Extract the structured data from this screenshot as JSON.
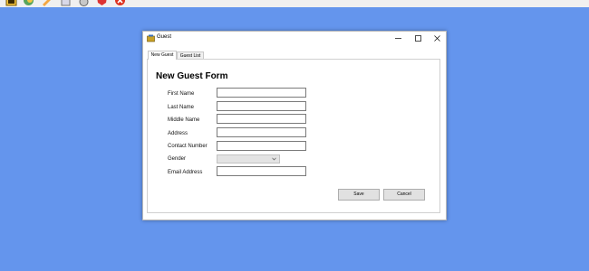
{
  "window": {
    "title": "Guest"
  },
  "tabs": [
    {
      "label": "New Guest",
      "active": true
    },
    {
      "label": "Guest List",
      "active": false
    }
  ],
  "form": {
    "title": "New Guest Form",
    "fields": {
      "first_name": {
        "label": "First Name",
        "value": ""
      },
      "last_name": {
        "label": "Last Name",
        "value": ""
      },
      "middle_name": {
        "label": "Middle Name",
        "value": ""
      },
      "address": {
        "label": "Address",
        "value": ""
      },
      "contact_number": {
        "label": "Contact Number",
        "value": ""
      },
      "gender": {
        "label": "Gender",
        "selected": ""
      },
      "email_address": {
        "label": "Email Address",
        "value": ""
      }
    },
    "buttons": {
      "save": "Save",
      "cancel": "Cancel"
    }
  },
  "colors": {
    "desktop": "#6495ED",
    "window": "#ffffff",
    "button": "#e1e1e1"
  },
  "taskbar_icons": [
    "folder-icon",
    "globe-icon",
    "pencil-icon",
    "document-icon",
    "network-icon",
    "shield-icon",
    "close-icon"
  ]
}
